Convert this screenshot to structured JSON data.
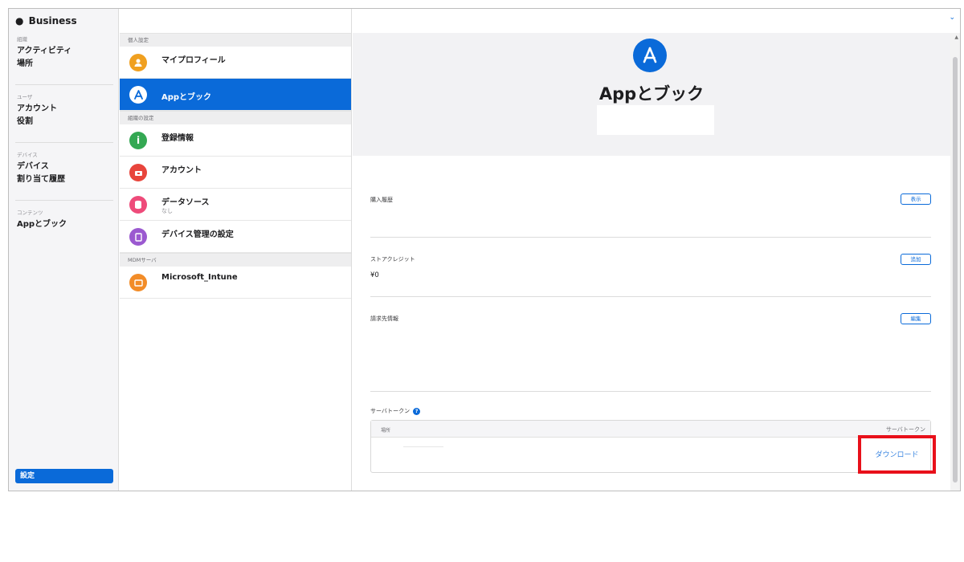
{
  "sidebar": {
    "brand": "Business",
    "sections": [
      {
        "label": "組織",
        "items": [
          "アクティビティ",
          "場所"
        ]
      },
      {
        "label": "ユーザ",
        "items": [
          "アカウント",
          "役割"
        ]
      },
      {
        "label": "デバイス",
        "items": [
          "デバイス",
          "割り当て履歴"
        ]
      },
      {
        "label": "コンテンツ",
        "items": [
          "Appとブック"
        ]
      }
    ],
    "settings_label": "設定"
  },
  "list": {
    "group_personal": "個人設定",
    "group_org": "組織の設定",
    "group_mdm": "MDMサーバ",
    "items": [
      {
        "title": "マイプロフィール",
        "subtitle": "",
        "color": "#f0a020"
      },
      {
        "title": "Appとブック",
        "subtitle": "",
        "color": "#0a6ad9",
        "selected": true
      },
      {
        "title": "登録情報",
        "subtitle": "",
        "color": "#34a853"
      },
      {
        "title": "アカウント",
        "subtitle": "",
        "color": "#e8453c"
      },
      {
        "title": "データソース",
        "subtitle": "なし",
        "color": "#ee4b7a"
      },
      {
        "title": "デバイス管理の設定",
        "subtitle": "",
        "color": "#9b59d0"
      },
      {
        "title": "Microsoft_Intune",
        "subtitle": "",
        "color": "#f28c28"
      }
    ]
  },
  "detail": {
    "title": "Appとブック",
    "purchase_history_label": "購入履歴",
    "purchase_history_button": "表示",
    "store_credit_label": "ストアクレジット",
    "store_credit_value": "¥0",
    "store_credit_button": "追加",
    "billing_label": "請求先情報",
    "billing_button": "編集",
    "server_token_label": "サーバトークン",
    "table": {
      "col_location": "場所",
      "col_token": "サーバトークン",
      "download_label": "ダウンロード"
    }
  },
  "colors": {
    "accent": "#0a6ad9",
    "highlight": "#e8101a"
  }
}
